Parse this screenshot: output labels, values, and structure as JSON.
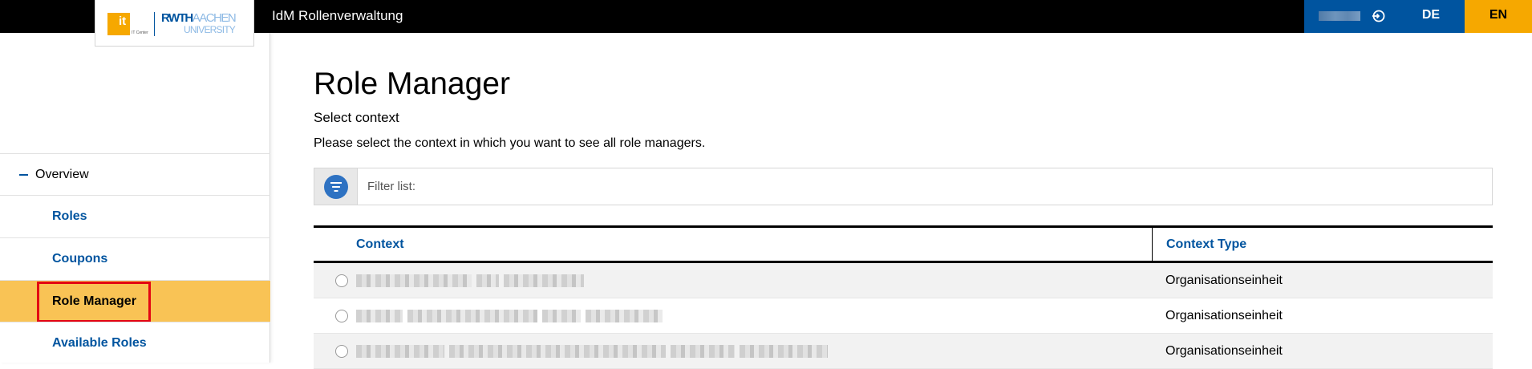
{
  "header": {
    "logo_sub": "IT Center",
    "logo_brand": "RWTH",
    "logo_brand2": "AACHEN",
    "logo_univ": "UNIVERSITY",
    "app_title": "IdM Rollenverwaltung",
    "lang_de": "DE",
    "lang_en": "EN",
    "user_icon": "logout-icon"
  },
  "sidebar": {
    "items": [
      {
        "label": "Overview"
      },
      {
        "label": "Roles"
      },
      {
        "label": "Coupons"
      },
      {
        "label": "Role Manager",
        "active": true
      },
      {
        "label": "Available Roles"
      }
    ]
  },
  "main": {
    "title": "Role Manager",
    "subheading": "Select context",
    "description": "Please select the context in which you want to see all role managers.",
    "filter_placeholder": "Filter list:",
    "table": {
      "columns": [
        "Context",
        "Context Type"
      ],
      "rows": [
        {
          "context_type": "Organisationseinheit"
        },
        {
          "context_type": "Organisationseinheit"
        },
        {
          "context_type": "Organisationseinheit"
        }
      ]
    }
  },
  "colors": {
    "accent_blue": "#00549f",
    "accent_yellow": "#f6a800",
    "active_nav": "#f9c355",
    "highlight_red": "#e30613"
  }
}
